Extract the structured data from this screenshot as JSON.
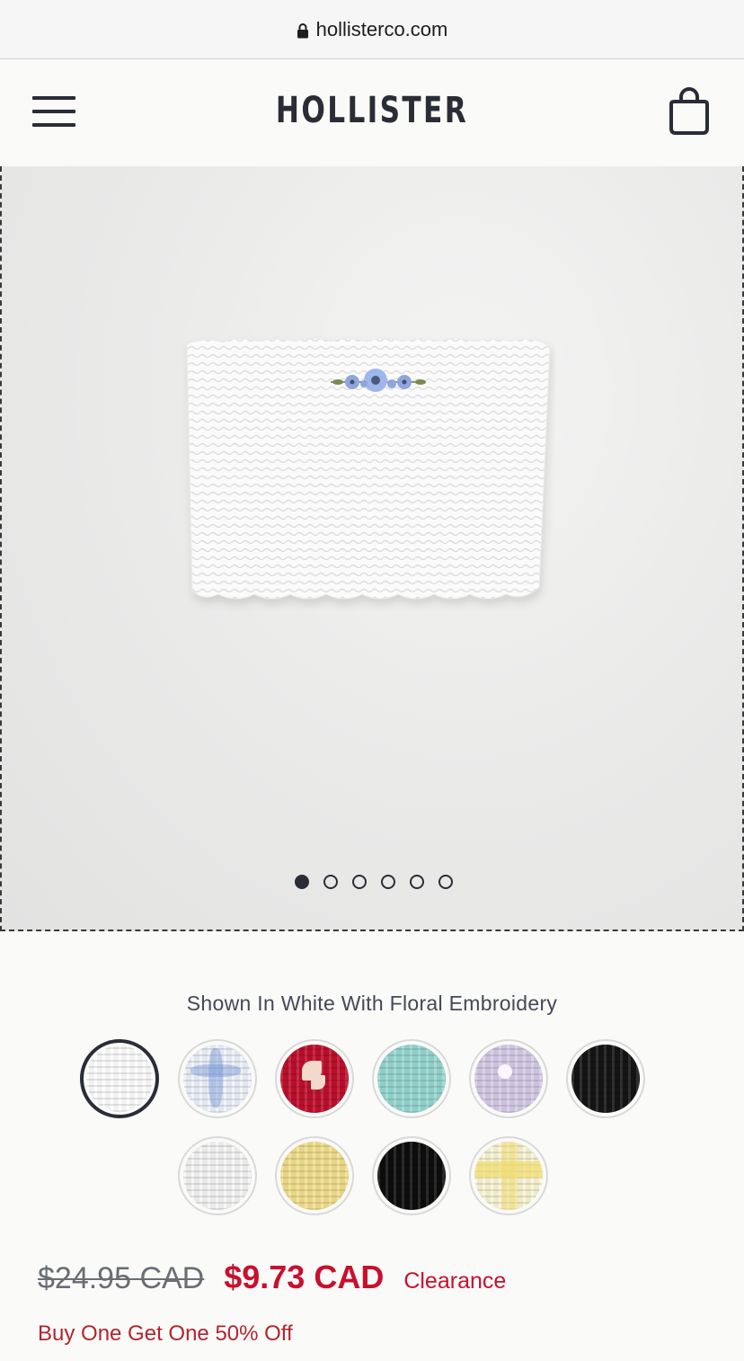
{
  "browser": {
    "url": "hollisterco.com",
    "lock_icon": "lock-icon"
  },
  "header": {
    "logo": "HOLLISTER",
    "menu_icon": "hamburger-menu-icon",
    "bag_icon": "shopping-bag-icon"
  },
  "gallery": {
    "image": "white smocked tube top with floral embroidery",
    "slides": 6,
    "active_slide": 1
  },
  "product": {
    "color_label": "Shown In White With Floral Embroidery",
    "swatches": [
      {
        "name": "white-floral-embroidery",
        "color": "#ffffff",
        "selected": true
      },
      {
        "name": "blue-white-plaid",
        "color": "#c6d6f0",
        "selected": false
      },
      {
        "name": "red-floral",
        "color": "#c0102c",
        "selected": false
      },
      {
        "name": "aqua",
        "color": "#98d8d2",
        "selected": false
      },
      {
        "name": "lavender-floral",
        "color": "#d8cce8",
        "selected": false
      },
      {
        "name": "black",
        "color": "#151515",
        "selected": false
      },
      {
        "name": "white",
        "color": "#f5f5f5",
        "selected": false
      },
      {
        "name": "yellow",
        "color": "#f2e08e",
        "selected": false
      },
      {
        "name": "black-2",
        "color": "#0d0d0d",
        "selected": false
      },
      {
        "name": "yellow-white-gingham",
        "color": "#f3e9a6",
        "selected": false
      }
    ],
    "old_price": "$24.95 CAD",
    "new_price": "$9.73 CAD",
    "badge": "Clearance",
    "promo": "Buy One Get One 50% Off"
  },
  "colors": {
    "text": "#2a2d36",
    "sale": "#c8102e"
  }
}
